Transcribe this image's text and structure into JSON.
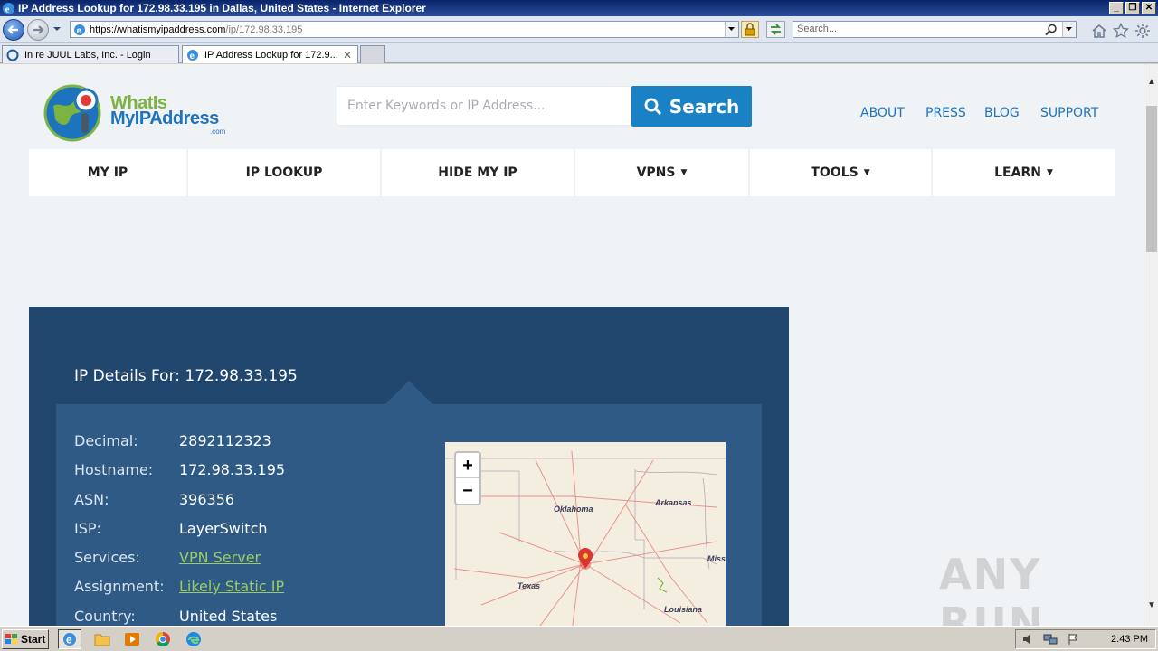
{
  "window": {
    "title": "IP Address Lookup for 172.98.33.195 in Dallas, United States - Internet Explorer",
    "controls": [
      "_",
      "❐",
      "✕"
    ]
  },
  "address_bar": {
    "url_host": "https://whatismyipaddress.com",
    "url_path": "/ip/172.98.33.195",
    "search_placeholder": "Search..."
  },
  "tabs": [
    {
      "label": "In re JUUL Labs, Inc. - Login",
      "active": false
    },
    {
      "label": "IP Address Lookup for 172.9...",
      "active": true
    }
  ],
  "site": {
    "logo": {
      "line1": "WhatIs",
      "line2": "MyIPAddress",
      "line3": ".com"
    },
    "search_placeholder": "Enter Keywords or IP Address...",
    "search_button": "Search",
    "top_links": [
      "ABOUT",
      "PRESS",
      "BLOG",
      "SUPPORT"
    ],
    "nav": [
      {
        "label": "MY IP",
        "caret": false
      },
      {
        "label": "IP LOOKUP",
        "caret": false
      },
      {
        "label": "HIDE MY IP",
        "caret": false
      },
      {
        "label": "VPNS",
        "caret": true
      },
      {
        "label": "TOOLS",
        "caret": true
      },
      {
        "label": "LEARN",
        "caret": true
      }
    ],
    "caret_glyph": "▼"
  },
  "details": {
    "title": "IP Details For: 172.98.33.195",
    "rows": [
      {
        "label": "Decimal:",
        "value": "2892112323",
        "link": false
      },
      {
        "label": "Hostname:",
        "value": "172.98.33.195",
        "link": false
      },
      {
        "label": "ASN:",
        "value": "396356",
        "link": false
      },
      {
        "label": "ISP:",
        "value": "LayerSwitch",
        "link": false
      },
      {
        "label": "Services:",
        "value": "VPN Server",
        "link": true
      },
      {
        "label": "Assignment:",
        "value": "Likely Static IP",
        "link": true
      },
      {
        "label": "Country:",
        "value": "United States",
        "link": false
      }
    ]
  },
  "map": {
    "zoom_in": "+",
    "zoom_out": "−",
    "labels": [
      "Oklahoma",
      "Arkansas",
      "Texas",
      "Louisiana",
      "Miss"
    ]
  },
  "watermark": "ANY RUN",
  "taskbar": {
    "start_label": "Start",
    "clock": "2:43 PM"
  },
  "colors": {
    "panel_bg": "#22476f",
    "panel_inner": "#2e5a85",
    "accent_blue": "#1a82c4",
    "link_green": "#9ccc65"
  }
}
